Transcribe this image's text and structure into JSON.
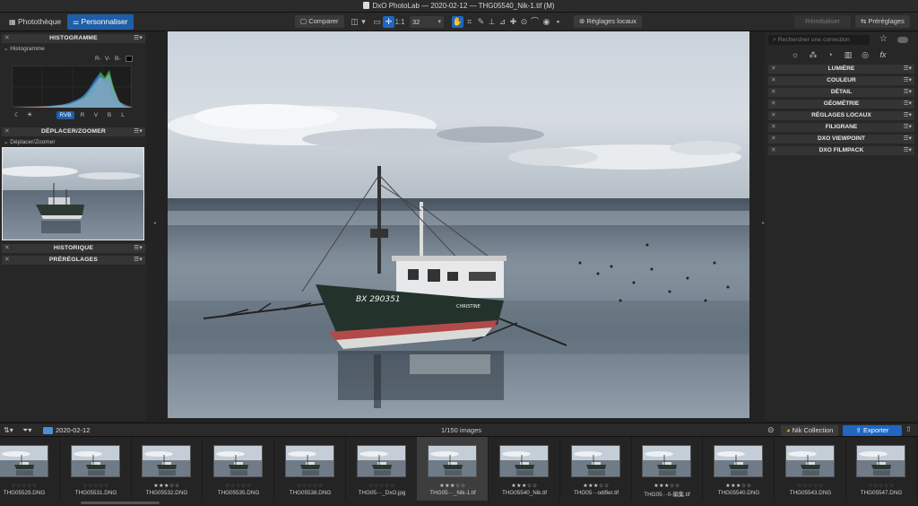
{
  "window": {
    "title": "DxO PhotoLab — 2020-02-12 — THG05540_Nik-1.tif (M)"
  },
  "toolbar": {
    "tabs": [
      {
        "label": "Photothèque",
        "icon": "grid-icon"
      },
      {
        "label": "Personnaliser",
        "icon": "sliders-icon"
      }
    ],
    "compare_label": "Comparer",
    "fit_label": "1:1",
    "zoom_value": "32",
    "local_adjust_label": "Réglages locaux",
    "reset_label": "Réinitialiser",
    "presets_label": "Préréglages"
  },
  "left_panel": {
    "histogram_title": "HISTOGRAMME",
    "histogram_sub": "Histogramme",
    "channel_indicators": [
      "R-",
      "V-",
      "B-"
    ],
    "channels": [
      "RVB",
      "R",
      "V",
      "B",
      "L"
    ],
    "selected_channel": "RVB",
    "move_zoom_title": "DÉPLACER/ZOOMER",
    "move_zoom_sub": "Déplacer/Zoomer",
    "history_title": "HISTORIQUE",
    "presets_title": "PRÉRÉGLAGES"
  },
  "right_panel": {
    "search_placeholder": "Rechercher une correction",
    "sections": [
      "LUMIÈRE",
      "COULEUR",
      "DÉTAIL",
      "GÉOMÉTRIE",
      "RÉGLAGES LOCAUX",
      "FILIGRANE",
      "DXO VIEWPOINT",
      "DXO FILMPACK"
    ],
    "tool_icons": [
      "sun-icon",
      "color-circles-icon",
      "detail-icon",
      "geometry-icon",
      "local-icon",
      "fx-icon"
    ]
  },
  "photo": {
    "boat_name": "BX 290351",
    "boat_label": "CHRISTINE"
  },
  "filmstrip_bar": {
    "folder": "2020-02-12",
    "count": "1/150 images",
    "nik_label": "Nik Collection",
    "export_label": "Exporter"
  },
  "filmstrip": [
    {
      "name": "THG05529.DNG",
      "stars": "☆☆☆☆☆",
      "rated": false
    },
    {
      "name": "THG05531.DNG",
      "stars": "☆☆☆☆☆",
      "rated": false
    },
    {
      "name": "THG05532.DNG",
      "stars": "★★★☆☆",
      "rated": true
    },
    {
      "name": "THG05535.DNG",
      "stars": "☆☆☆☆☆",
      "rated": false
    },
    {
      "name": "THG05538.DNG",
      "stars": "☆☆☆☆☆",
      "rated": false
    },
    {
      "name": "THG05···_DxO.jpg",
      "stars": "☆☆☆☆☆",
      "rated": false
    },
    {
      "name": "THG05···_Nik-1.tif",
      "stars": "★★★☆☆",
      "rated": true
    },
    {
      "name": "THG05540_Nik.tif",
      "stars": "★★★☆☆",
      "rated": true
    },
    {
      "name": "THG05···odifier.tif",
      "stars": "★★★☆☆",
      "rated": true
    },
    {
      "name": "THG05···0-編集.tif",
      "stars": "★★★☆☆",
      "rated": true
    },
    {
      "name": "THG05540.DNG",
      "stars": "★★★☆☆",
      "rated": true
    },
    {
      "name": "THG05543.DNG",
      "stars": "☆☆☆☆☆",
      "rated": false
    },
    {
      "name": "THG05547.DNG",
      "stars": "☆☆☆☆☆",
      "rated": false
    }
  ],
  "colors": {
    "accent": "#1f5ea8",
    "panel": "#272727",
    "header": "#353535"
  }
}
